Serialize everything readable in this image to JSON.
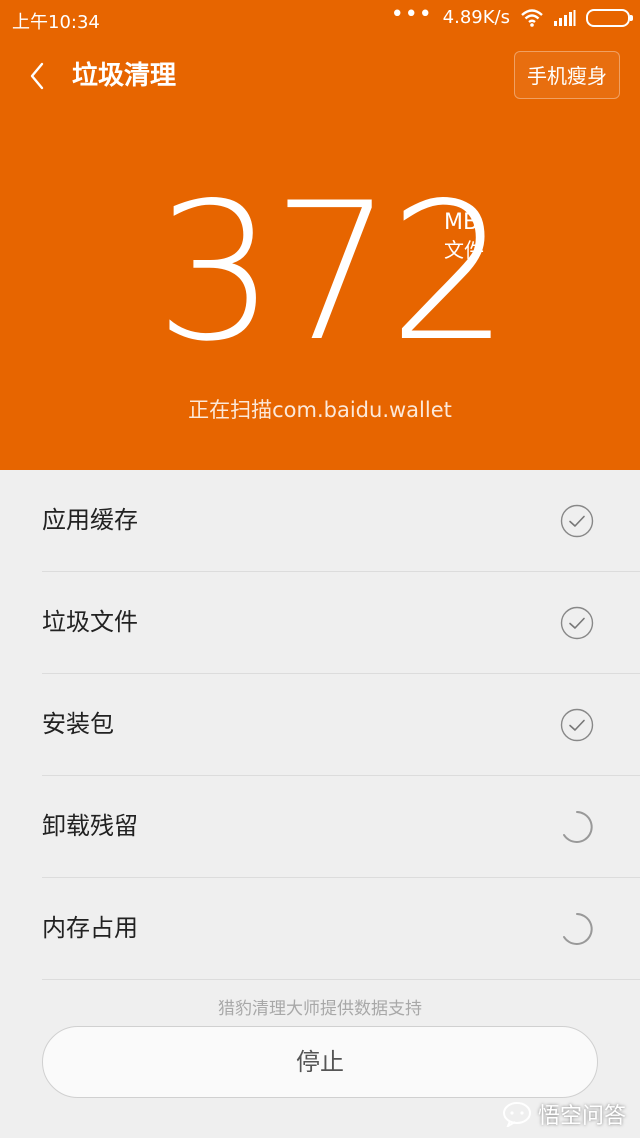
{
  "status_bar": {
    "time": "上午10:34",
    "dots": "•••",
    "speed": "4.89K/s",
    "icons": [
      "wifi-icon",
      "signal-icon",
      "battery-icon"
    ]
  },
  "header": {
    "title": "垃圾清理",
    "slim_button": "手机瘦身",
    "size_value": "372",
    "size_unit": "MB",
    "size_sub": "文件",
    "scan_text": "正在扫描com.baidu.wallet",
    "color": "#e76500"
  },
  "items": [
    {
      "label": "应用缓存",
      "status": "done"
    },
    {
      "label": "垃圾文件",
      "status": "done"
    },
    {
      "label": "安装包",
      "status": "done"
    },
    {
      "label": "卸载残留",
      "status": "scanning"
    },
    {
      "label": "内存占用",
      "status": "scanning"
    }
  ],
  "footer": {
    "credit": "猎豹清理大师提供数据支持",
    "stop_button": "停止"
  },
  "watermark": {
    "text": "悟空问答"
  }
}
